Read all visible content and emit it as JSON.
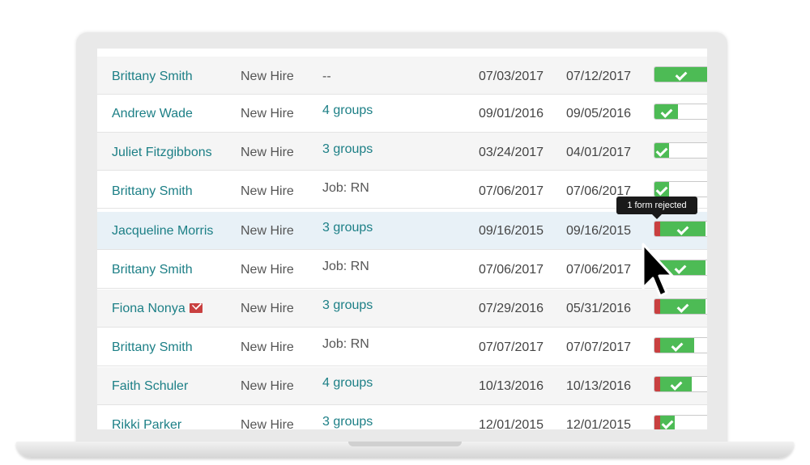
{
  "tooltip": {
    "text": "1 form rejected"
  },
  "colors": {
    "link": "#1c7f86",
    "progress_green": "#4dbb55",
    "progress_red": "#c94040"
  },
  "rows": [
    {
      "name": "Brittany Smith",
      "type": "New Hire",
      "groups": "--",
      "groups_is_link": false,
      "date_start": "07/03/2017",
      "date_due": "07/12/2017",
      "progress": {
        "rejected": 0.0,
        "complete": 0.93
      }
    },
    {
      "name": "Andrew Wade",
      "type": "New Hire",
      "groups": "4 groups",
      "groups_is_link": true,
      "date_start": "09/01/2016",
      "date_due": "09/05/2016",
      "progress": {
        "rejected": 0.0,
        "complete": 0.42
      }
    },
    {
      "name": "Juliet Fitzgibbons",
      "type": "New Hire",
      "groups": "3 groups",
      "groups_is_link": true,
      "date_start": "03/24/2017",
      "date_due": "04/01/2017",
      "progress": {
        "rejected": 0.0,
        "complete": 0.25
      }
    },
    {
      "name": "Brittany Smith",
      "type": "New Hire",
      "groups": "Job: RN",
      "groups_is_link": false,
      "date_start": "07/06/2017",
      "date_due": "07/06/2017",
      "progress": {
        "rejected": 0.0,
        "complete": 0.25
      }
    },
    {
      "name": "Jacqueline Morris",
      "type": "New Hire",
      "groups": "3 groups",
      "groups_is_link": true,
      "date_start": "09/16/2015",
      "date_due": "09/16/2015",
      "progress": {
        "rejected": 0.1,
        "complete": 0.9
      }
    },
    {
      "name": "Brittany Smith",
      "type": "New Hire",
      "groups": "Job: RN",
      "groups_is_link": false,
      "date_start": "07/06/2017",
      "date_due": "07/06/2017",
      "progress": {
        "rejected": 0.0,
        "complete": 0.9
      }
    },
    {
      "name": "Fiona Nonya",
      "type": "New Hire",
      "groups": "3 groups",
      "groups_is_link": true,
      "date_start": "07/29/2016",
      "date_due": "05/31/2016",
      "has_mail_icon": true,
      "progress": {
        "rejected": 0.1,
        "complete": 0.9
      }
    },
    {
      "name": "Brittany Smith",
      "type": "New Hire",
      "groups": "Job: RN",
      "groups_is_link": false,
      "date_start": "07/07/2017",
      "date_due": "07/07/2017",
      "progress": {
        "rejected": 0.1,
        "complete": 0.7
      }
    },
    {
      "name": "Faith Schuler",
      "type": "New Hire",
      "groups": "4 groups",
      "groups_is_link": true,
      "date_start": "10/13/2016",
      "date_due": "10/13/2016",
      "progress": {
        "rejected": 0.1,
        "complete": 0.65
      }
    },
    {
      "name": "Rikki Parker",
      "type": "New Hire",
      "groups": "3 groups",
      "groups_is_link": true,
      "date_start": "12/01/2015",
      "date_due": "12/01/2015",
      "progress": {
        "rejected": 0.1,
        "complete": 0.35
      }
    }
  ]
}
